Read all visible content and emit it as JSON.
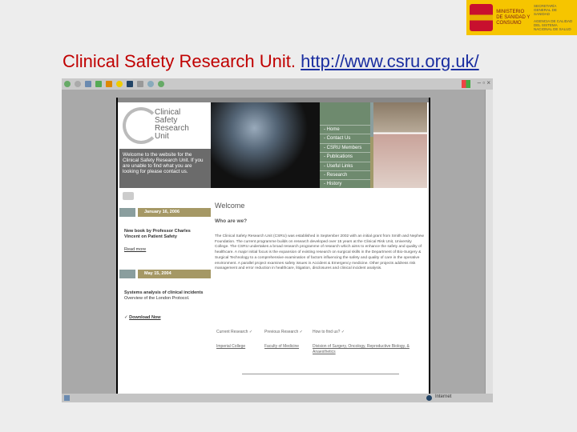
{
  "slide": {
    "title": "Clinical Safety Research Unit.",
    "url": "http://www.csru.org.uk/"
  },
  "logo": {
    "ministry": "MINISTERIO DE SANIDAD Y CONSUMO",
    "agency": "SECRETARÍA GENERAL DE SANIDAD",
    "dept": "AGENCIA DE CALIDAD DEL SISTEMA NACIONAL DE SALUD"
  },
  "site": {
    "logo_text": "Clinical Safety Research Unit",
    "welcome": "Welcome to the website for the Clinical Safety Research Unit. If you are unable to find what you are looking for please contact us.",
    "nav": [
      "Home",
      "Contact Us",
      "CSRU Members",
      "Publications",
      "Useful Links",
      "Research",
      "History"
    ],
    "news": [
      {
        "date": "January 16, 2006",
        "title": "New book by Professor Charles Vincent on Patient Safety",
        "link": "Read more"
      },
      {
        "date": "May 15, 2004",
        "title": "Systems analysis of clinical incidents",
        "desc": "Overview of the London Protocol.",
        "link": "Download Now"
      }
    ],
    "heading": "Welcome",
    "subheading": "Who are we?",
    "body": "The Clinical Safety Research Unit (CSRU) was established in September 2002 with an initial grant from Smith and Nephew Foundation. The current programme builds on research developed over 15 years at the Clinical Risk Unit, University College. The CSRU undertakes a broad research programme of research which aims to enhance the safety and quality of healthcare. A major initial focus is the expansion of existing research on surgical skills in the Department of Bio-Surgery & Surgical Technology to a comprehensive examination of factors influencing the safety and quality of care in the operative environment. A parallel project examines safety issues in Accident & Emergency medicine. Other projects address risk management and error reduction in healthcare, litigation, disclosures and clinical incident analysis.",
    "footer_links": [
      "Current Research",
      "Previous Research",
      "How to find us?"
    ],
    "footer_orgs": [
      "Imperial College",
      "Faculty of Medicine",
      "Division of Surgery, Oncology, Reproductive Biology, & Anaesthetics"
    ]
  },
  "browser": {
    "status_zone": "Internet"
  }
}
